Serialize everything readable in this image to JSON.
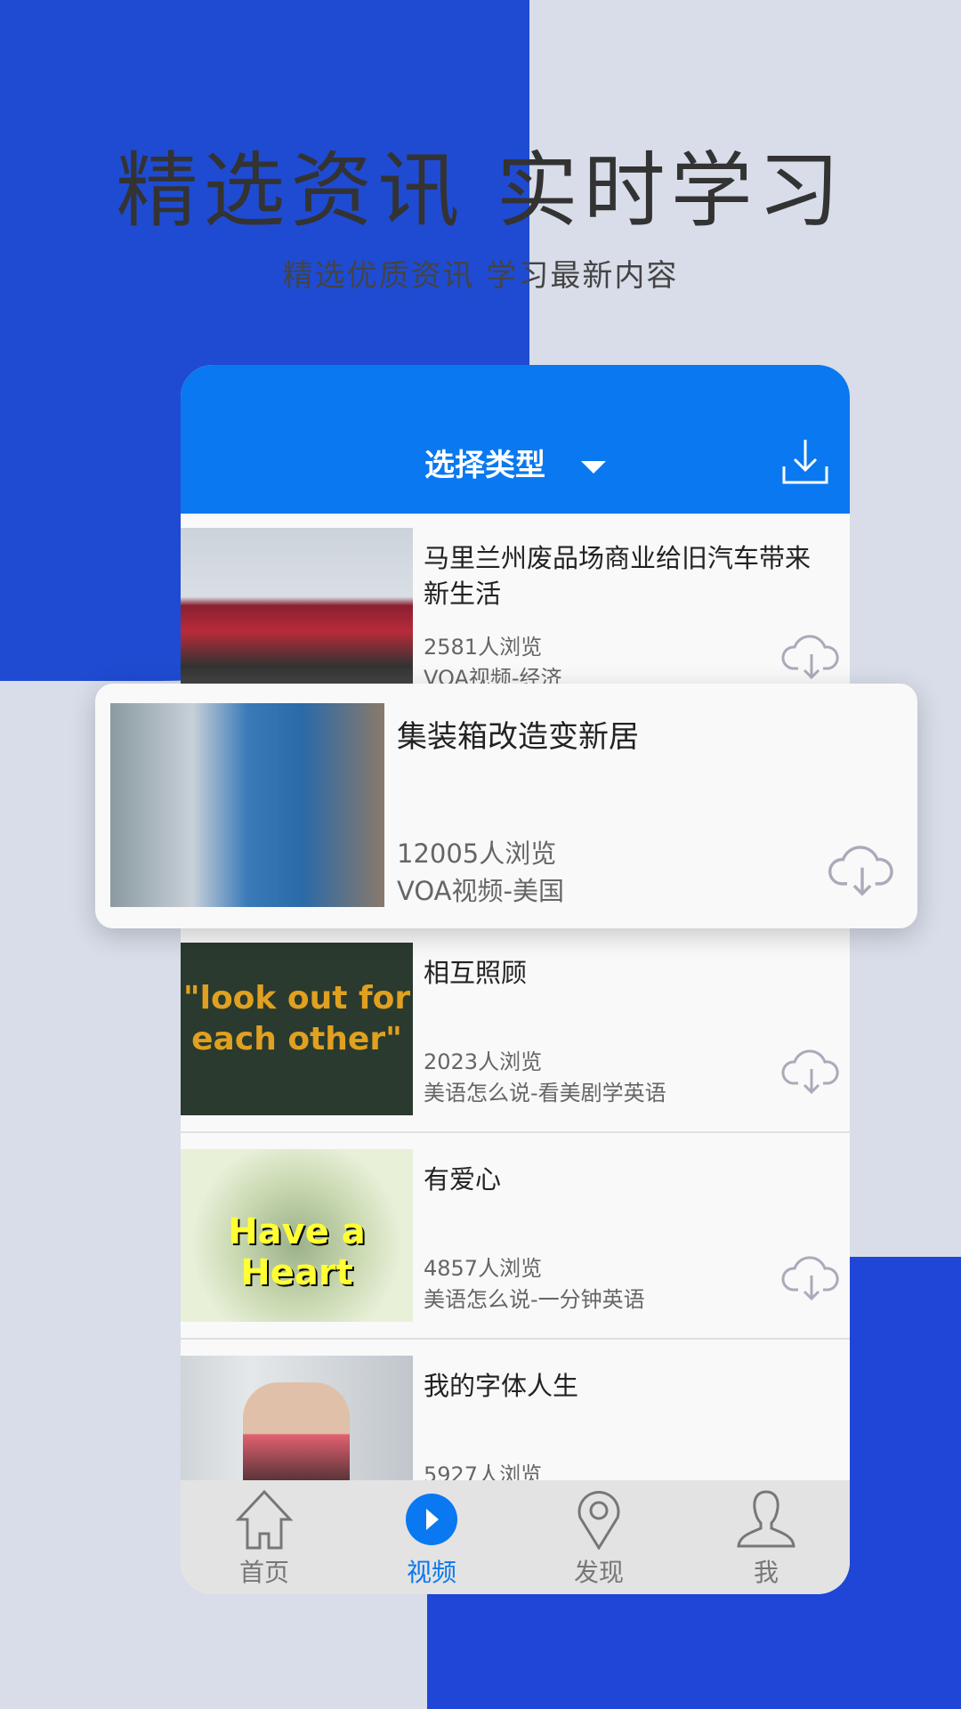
{
  "headline": "精选资讯 实时学习",
  "subheadline": "精选优质资讯   学习最新内容",
  "header": {
    "select_label": "选择类型",
    "icons": [
      "chevron-down-icon",
      "download-icon"
    ]
  },
  "items": [
    {
      "title": "马里兰州废品场商业给旧汽车带来新生活",
      "views": "2581人浏览",
      "category": "VOA视频-经济"
    },
    {
      "title": "集装箱改造变新居",
      "views": "12005人浏览",
      "category": "VOA视频-美国"
    },
    {
      "title": "相互照顾",
      "views": "2023人浏览",
      "category": "美语怎么说-看美剧学英语",
      "thumb_text": "\"look out for each other\""
    },
    {
      "title": "有爱心",
      "views": "4857人浏览",
      "category": "美语怎么说-一分钟英语",
      "thumb_text": "Have a Heart"
    },
    {
      "title": "我的字体人生",
      "views": "5927人浏览",
      "category": ""
    }
  ],
  "nav": [
    {
      "label": "首页",
      "icon": "home-icon"
    },
    {
      "label": "视频",
      "icon": "play-icon",
      "active": true
    },
    {
      "label": "发现",
      "icon": "location-icon"
    },
    {
      "label": "我",
      "icon": "user-icon"
    }
  ],
  "colors": {
    "accent": "#0a78f0",
    "blob": "#1f4bd2",
    "background": "#d8dde9"
  }
}
